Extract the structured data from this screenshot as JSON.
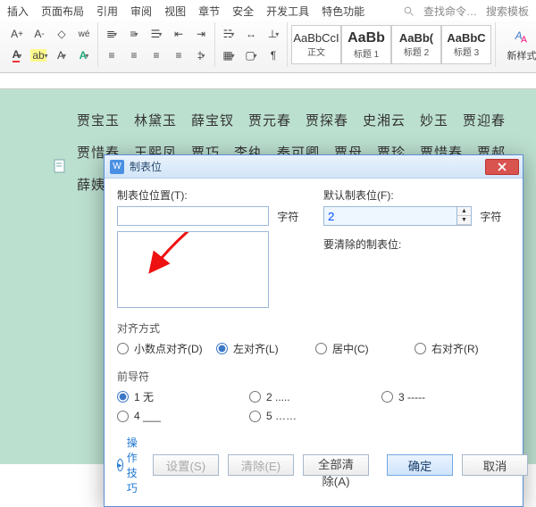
{
  "ribbon_tabs": [
    "插入",
    "页面布局",
    "引用",
    "审阅",
    "视图",
    "章节",
    "安全",
    "开发工具",
    "特色功能"
  ],
  "search": {
    "find": "查找命令…",
    "templates": "搜索模板"
  },
  "styles": [
    {
      "preview": "AaBbCcI",
      "label": "正文"
    },
    {
      "preview": "AaBb",
      "label": "标题 1"
    },
    {
      "preview": "AaBb(",
      "label": "标题 2"
    },
    {
      "preview": "AaBbC",
      "label": "标题 3"
    }
  ],
  "new_style_label": "新样式",
  "doc_text": "贾宝玉　林黛玉　薛宝钗　贾元春　贾探春　史湘云　妙玉　贾迎春　贾惜春　王熙凤　贾巧　李纨　秦可卿　贾母　贾珍　贾惜春　贾郝　薛姨妈　薛宝",
  "dialog": {
    "title": "制表位",
    "labels": {
      "tab_position": "制表位位置(T):",
      "default_tab": "默认制表位(F):",
      "unit": "字符",
      "to_clear": "要清除的制表位:",
      "alignment": "对齐方式",
      "leader": "前导符"
    },
    "default_tab_value": "2",
    "alignment": [
      {
        "label": "小数点对齐(D)",
        "checked": false
      },
      {
        "label": "左对齐(L)",
        "checked": true
      },
      {
        "label": "居中(C)",
        "checked": false
      },
      {
        "label": "右对齐(R)",
        "checked": false
      }
    ],
    "leader": [
      {
        "label": "1 无",
        "checked": true
      },
      {
        "label": "2 .....",
        "checked": false
      },
      {
        "label": "3 -----",
        "checked": false
      },
      {
        "label": "4 ___",
        "checked": false
      },
      {
        "label": "5 ……",
        "checked": false
      }
    ],
    "footer": {
      "tips": "操作技巧",
      "set": "设置(S)",
      "clear": "清除(E)",
      "clear_all": "全部清除(A)",
      "ok": "确定",
      "cancel": "取消"
    }
  }
}
